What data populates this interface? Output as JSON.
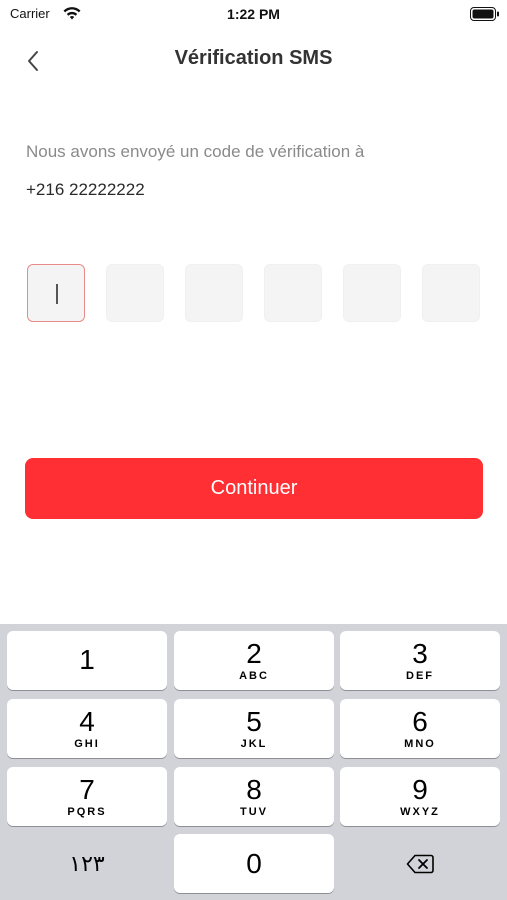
{
  "status_bar": {
    "carrier": "Carrier",
    "time": "1:22 PM"
  },
  "nav": {
    "title": "Vérification SMS"
  },
  "content": {
    "subtitle": "Nous avons envoyé un code de vérification à",
    "phone": "+216 22222222",
    "code_length": 6
  },
  "actions": {
    "continue_label": "Continuer"
  },
  "keyboard": {
    "keys": [
      {
        "num": "1",
        "letters": ""
      },
      {
        "num": "2",
        "letters": "ABC"
      },
      {
        "num": "3",
        "letters": "DEF"
      },
      {
        "num": "4",
        "letters": "GHI"
      },
      {
        "num": "5",
        "letters": "JKL"
      },
      {
        "num": "6",
        "letters": "MNO"
      },
      {
        "num": "7",
        "letters": "PQRS"
      },
      {
        "num": "8",
        "letters": "TUV"
      },
      {
        "num": "9",
        "letters": "WXYZ"
      }
    ],
    "mode_key": "١٢٣",
    "zero": "0"
  },
  "colors": {
    "accent": "#ff2f34",
    "active_border": "#e98a8a"
  }
}
